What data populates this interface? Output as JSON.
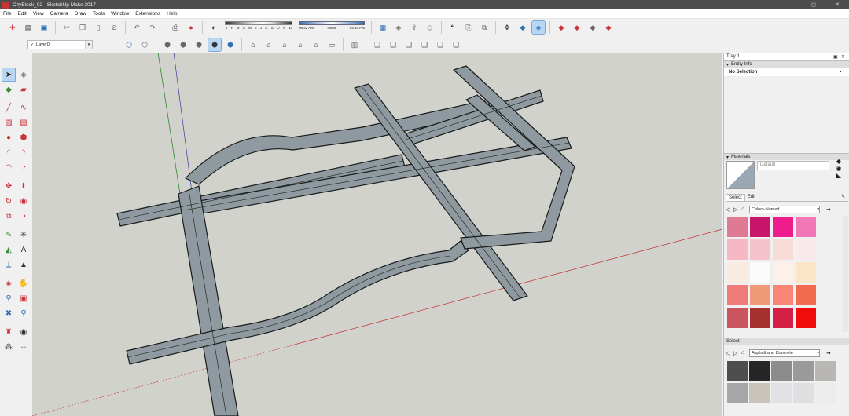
{
  "window": {
    "title": "CityBlock_02 - SketchUp Make 2017",
    "minimize": "–",
    "maximize": "◻",
    "close": "✕"
  },
  "menu": [
    "File",
    "Edit",
    "View",
    "Camera",
    "Draw",
    "Tools",
    "Window",
    "Extensions",
    "Help"
  ],
  "shadow": {
    "months": [
      "J",
      "F",
      "M",
      "A",
      "M",
      "J",
      "J",
      "A",
      "S",
      "O",
      "N",
      "D"
    ],
    "time_start": "06:42 AM",
    "time_mid": "Noon",
    "time_end": "04:46 PM"
  },
  "layer": {
    "check": "✓",
    "name": "Layer0",
    "dropdown": "▾"
  },
  "tray": {
    "title": "Tray 1",
    "entity_info": {
      "header": "Entity Info",
      "selection": "No Selection"
    },
    "materials": {
      "header": "Materials",
      "default_name": "Default",
      "tabs": [
        "Select",
        "Edit"
      ],
      "collection": "Colors-Named",
      "colors": [
        "#de7a93",
        "#c9166d",
        "#ef1c8d",
        "#f277b6",
        "#f7b8c5",
        "#f5c2cd",
        "#f7dcd8",
        "#f8e9ea",
        "#f9ebdf",
        "#fbfbfb",
        "#fcf0e8",
        "#fce4c7",
        "#ef7b7b",
        "#ee9a78",
        "#f98577",
        "#f26b4e",
        "#c9555e",
        "#a5302d",
        "#d42046",
        "#f20b0b"
      ],
      "select_label": "Select",
      "collection2": "Asphalt and Concrete",
      "materials": [
        "#4e4e4e",
        "#262626",
        "#8c8c8c",
        "#9a9a9a",
        "#b9b7b4",
        "#a6a6a6",
        "#c9c3b9",
        "#e2e2e6",
        "#dfdfdf",
        "#ececec"
      ]
    }
  },
  "icons": {
    "tray_pin": "▣",
    "tray_close": "✕",
    "lock": "🔒",
    "section_arrow": "▾",
    "home": "⌂",
    "back": "◁",
    "forward": "▷"
  }
}
